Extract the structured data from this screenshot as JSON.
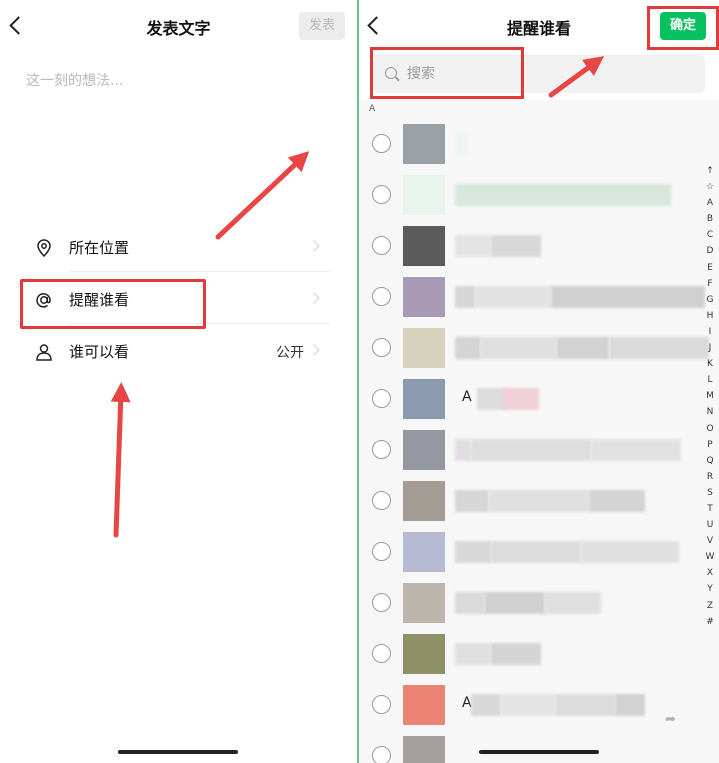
{
  "left": {
    "header": {
      "title": "发表文字",
      "send_label": "发表"
    },
    "placeholder": "这一刻的想法...",
    "options": {
      "location": {
        "label": "所在位置",
        "icon": "location-pin-icon"
      },
      "remind": {
        "label": "提醒谁看",
        "icon": "at-sign-icon"
      },
      "visible": {
        "label": "谁可以看",
        "value": "公开",
        "icon": "person-icon"
      }
    }
  },
  "right": {
    "header": {
      "title": "提醒谁看",
      "confirm_label": "确定"
    },
    "search": {
      "placeholder": "搜索",
      "icon": "search-icon"
    },
    "section_letter": "A",
    "index_letters": [
      "↑",
      "☆",
      "A",
      "B",
      "C",
      "D",
      "E",
      "F",
      "G",
      "H",
      "I",
      "J",
      "K",
      "L",
      "M",
      "N",
      "O",
      "P",
      "Q",
      "R",
      "S",
      "T",
      "U",
      "V",
      "W",
      "X",
      "Y",
      "Z",
      "#"
    ],
    "contacts": [
      {
        "avatar_color": "#9aa1a6",
        "name": ""
      },
      {
        "avatar_color": "#e8f4ec",
        "name": ""
      },
      {
        "avatar_color": "#5b5b5b",
        "name": ""
      },
      {
        "avatar_color": "#a99bb6",
        "name": ""
      },
      {
        "avatar_color": "#d6d2bc",
        "name": ""
      },
      {
        "avatar_color": "#8b9aae",
        "name": "A"
      },
      {
        "avatar_color": "#9598a1",
        "name": ""
      },
      {
        "avatar_color": "#a29c95",
        "name": ""
      },
      {
        "avatar_color": "#b6bad2",
        "name": ""
      },
      {
        "avatar_color": "#bcb6ad",
        "name": ""
      },
      {
        "avatar_color": "#8e9066",
        "name": ""
      },
      {
        "avatar_color": "#ec8473",
        "name": "A"
      },
      {
        "avatar_color": "#a3a19e",
        "name": ""
      }
    ]
  },
  "colors": {
    "accent_green": "#07c160",
    "highlight_red": "#e23a3a"
  }
}
